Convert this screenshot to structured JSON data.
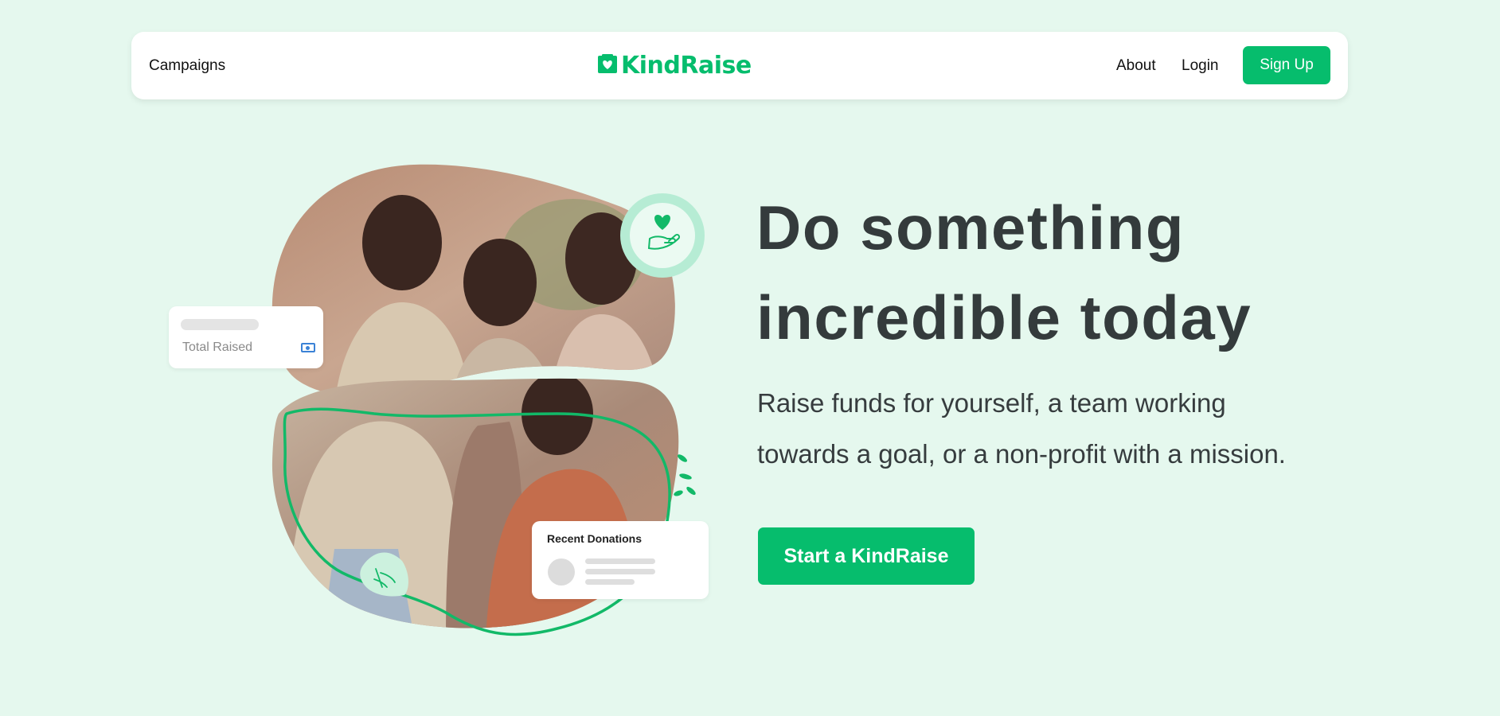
{
  "nav": {
    "campaigns_label": "Campaigns",
    "logo_text": "KindRaise",
    "about_label": "About",
    "login_label": "Login",
    "signup_label": "Sign Up"
  },
  "hero": {
    "headline_line1": "Do something",
    "headline_line2": "incredible today",
    "subtext_line1": "Raise funds for yourself, a team working",
    "subtext_line2": "towards a goal, or a non-profit with a mission.",
    "cta_label": "Start a KindRaise"
  },
  "illustration": {
    "total_card_label": "Total Raised",
    "recent_card_title": "Recent Donations",
    "photo_subject": "group of smiling children",
    "icons": [
      "heart-hand-icon",
      "money-icon",
      "handshake-icon"
    ]
  },
  "colors": {
    "accent": "#06bd6d",
    "background": "#e5f8ee",
    "headline": "#343b3c"
  }
}
